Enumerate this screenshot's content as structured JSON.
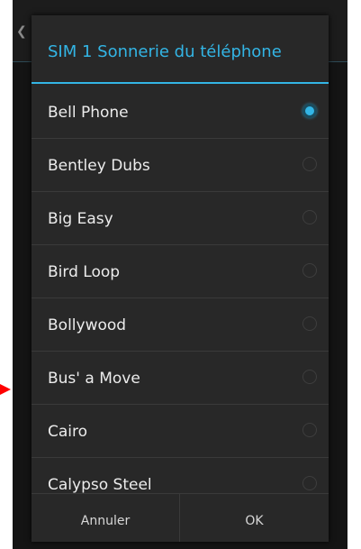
{
  "background": {
    "back_glyph": "❮"
  },
  "dialog": {
    "title": "SIM 1 Sonnerie du téléphone",
    "items": [
      {
        "label": "Bell Phone",
        "selected": true
      },
      {
        "label": "Bentley Dubs",
        "selected": false
      },
      {
        "label": "Big Easy",
        "selected": false
      },
      {
        "label": "Bird Loop",
        "selected": false
      },
      {
        "label": "Bollywood",
        "selected": false
      },
      {
        "label": "Bus' a Move",
        "selected": false
      },
      {
        "label": "Cairo",
        "selected": false
      },
      {
        "label": "Calypso Steel",
        "selected": false
      }
    ],
    "cancel_label": "Annuler",
    "ok_label": "OK"
  },
  "colors": {
    "accent": "#33b5e5",
    "dialog_bg": "#282828",
    "annotation_arrow": "#ff0000"
  },
  "icons": {
    "radio": "radio-button-icon",
    "back": "back-arrow-icon",
    "annotation": "annotation-arrow-icon"
  }
}
